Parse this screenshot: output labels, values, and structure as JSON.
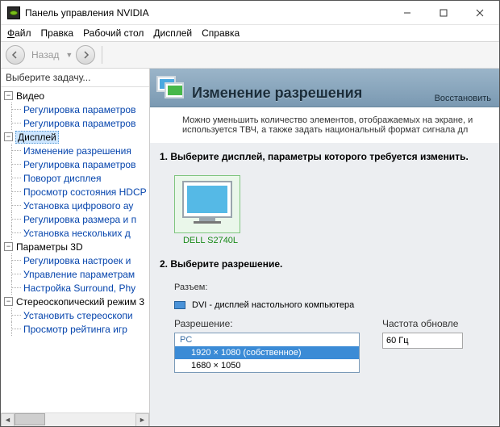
{
  "window": {
    "title": "Панель управления NVIDIA"
  },
  "menu": {
    "file": "Файл",
    "edit": "Правка",
    "desktop": "Рабочий стол",
    "display": "Дисплей",
    "help": "Справка"
  },
  "toolbar": {
    "back": "Назад"
  },
  "sidebar": {
    "heading": "Выберите задачу...",
    "groups": [
      {
        "label": "Видео",
        "items": [
          "Регулировка параметров",
          "Регулировка параметров"
        ]
      },
      {
        "label": "Дисплей",
        "selected": true,
        "items": [
          "Изменение разрешения",
          "Регулировка параметров",
          "Поворот дисплея",
          "Просмотр состояния HDCP",
          "Установка цифрового ау",
          "Регулировка размера и п",
          "Установка нескольких д"
        ]
      },
      {
        "label": "Параметры 3D",
        "items": [
          "Регулировка настроек и",
          "Управление параметрам",
          "Настройка Surround, Phy"
        ]
      },
      {
        "label": "Стереоскопический режим 3",
        "items": [
          "Установить стереоскопи",
          "Просмотр рейтинга игр"
        ]
      }
    ]
  },
  "page": {
    "title": "Изменение разрешения",
    "restore": "Восстановить",
    "desc": "Можно уменьшить количество элементов, отображаемых на экране, и используется ТВЧ, а также задать национальный формат сигнала дл",
    "step1": "1. Выберите дисплей, параметры которого требуется изменить.",
    "monitor": "DELL S2740L",
    "step2": "2. Выберите разрешение.",
    "connector_label": "Разъем:",
    "connector_value": "DVI - дисплей настольного компьютера",
    "resolution_label": "Разрешение:",
    "refresh_label": "Частота обновле",
    "res_group": "PC",
    "res_options": [
      "1920 × 1080 (собственное)",
      "1680 × 1050"
    ],
    "refresh_value": "60 Гц"
  }
}
